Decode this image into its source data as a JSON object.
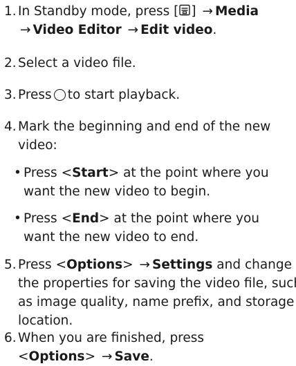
{
  "steps": [
    {
      "num": "1.",
      "pre": "In Standby mode, press [",
      "menu_icon": "menu-key-icon",
      "post": "]",
      "items": [
        "Media",
        "Video Editor",
        "Edit video"
      ],
      "end": "."
    },
    {
      "num": "2.",
      "text": "Select a video file."
    },
    {
      "num": "3.",
      "pre": "Press",
      "key_icon": "ok-key-icon",
      "post": "to start playback."
    },
    {
      "num": "4.",
      "text": "Mark the beginning and end of the new video:",
      "bullets": [
        {
          "bullet": "•",
          "pre": "Press <",
          "key": "Start",
          "post": "> at the point where you want the new video to begin."
        },
        {
          "bullet": "•",
          "pre": "Press <",
          "key": "End",
          "post": "> at the point where you want the new video to end."
        }
      ]
    },
    {
      "num": "5.",
      "pre": "Press <",
      "key": "Options",
      "mid": ">",
      "item": "Settings",
      "post": "and change the properties for saving the video file, such as image quality, name prefix, and storage location."
    },
    {
      "num": "6.",
      "pre": "When you are finished, press <",
      "key": "Options",
      "mid": ">",
      "item": "Save",
      "end": "."
    }
  ],
  "arrow": "→"
}
